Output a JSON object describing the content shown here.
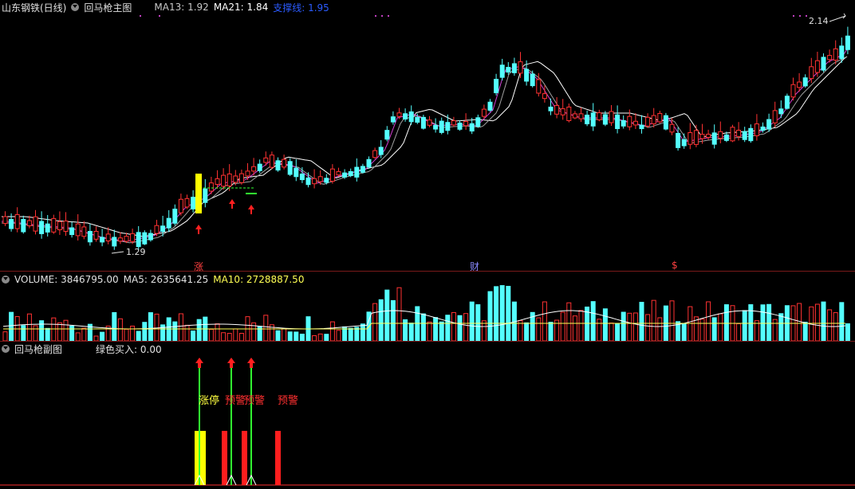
{
  "main": {
    "stock_title": "山东钢铁(日线)",
    "indicator_name": "回马枪主图",
    "ma13_label": "MA13: 1.92",
    "ma21_label": "MA21: 1.84",
    "support_label": "支撑线: 1.95",
    "high_label": "2.14",
    "low_label": "1.29",
    "colors": {
      "up": "#ff3232",
      "down": "#54ffff",
      "ma13": "#e4e4e4",
      "ma21": "#ffff54",
      "support": "#2020ff"
    }
  },
  "markers": {
    "limit": "涨",
    "finance": "财",
    "dividend": "$"
  },
  "volume": {
    "volume_label": "VOLUME: 3846795.00",
    "ma5_label": "MA5: 2635641.25",
    "ma10_label": "MA10: 2728887.50"
  },
  "sub": {
    "indicator_name": "回马枪副图",
    "green_buy_label": "绿色买入: 0.00",
    "limit_up_text": "涨停",
    "warn_text": "预警"
  }
}
